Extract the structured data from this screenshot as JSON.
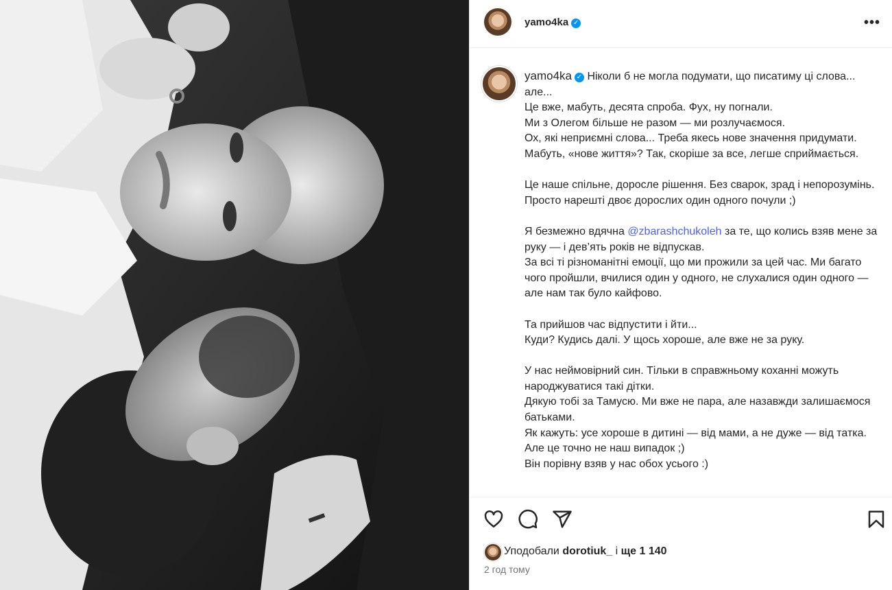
{
  "post": {
    "username": "yamo4ka",
    "verified_mark": "✓"
  },
  "caption": {
    "username": "yamo4ka",
    "first_line": "Ніколи б не могла подумати, що писатиму ці слова... але...",
    "lines": [
      "Це вже, мабуть, десята спроба. Фух, ну погнали.",
      "Ми з Олегом більше не разом — ми розлучаємося.",
      "Ох, які неприємні слова... Треба якесь нове значення придумати.",
      "Мабуть, «нове життя»? Так, скоріше за все, легше сприймається."
    ],
    "p2": "Це наше спільне, доросле рішення. Без сварок, зрад і непорозумінь. Просто нарешті двоє дорослих один одного почули ;)",
    "p3_before": "Я безмежно вдячна ",
    "mention": "@zbarashchukoleh",
    "p3_after": " за те, що колись взяв мене за руку — і дев’ять років не відпускав.",
    "p3b": "За всі ті різноманітні емоції, що ми прожили за цей час. Ми багато чого пройшли, вчилися один у одного, не слухалися один одного — але нам так було кайфово.",
    "p4a": "Та прийшов час відпустити і йти...",
    "p4b": "Куди? Кудись далі. У щось хороше, але вже не за руку.",
    "p5a": "У нас неймовірний син. Тільки в справжньому коханні можуть народжуватися такі дітки.",
    "p5b": "Дякую тобі за Тамусю. Ми вже не пара, але назавжди залишаємося батьками.",
    "p5c": "Як кажуть: усе хороше в дитині — від мами, а не дуже — від татка. Але це точно не наш випадок ;)",
    "p5d": "Він порівну взяв у нас обох усього :)"
  },
  "likes": {
    "prefix": "Уподобали",
    "user": "dorotiuk_",
    "middle": "і",
    "count": "ще 1 140"
  },
  "time": "2 год тому",
  "icons": {
    "more": "more-options-icon",
    "like": "heart-icon",
    "comment": "comment-icon",
    "share": "share-icon",
    "save": "bookmark-icon"
  }
}
